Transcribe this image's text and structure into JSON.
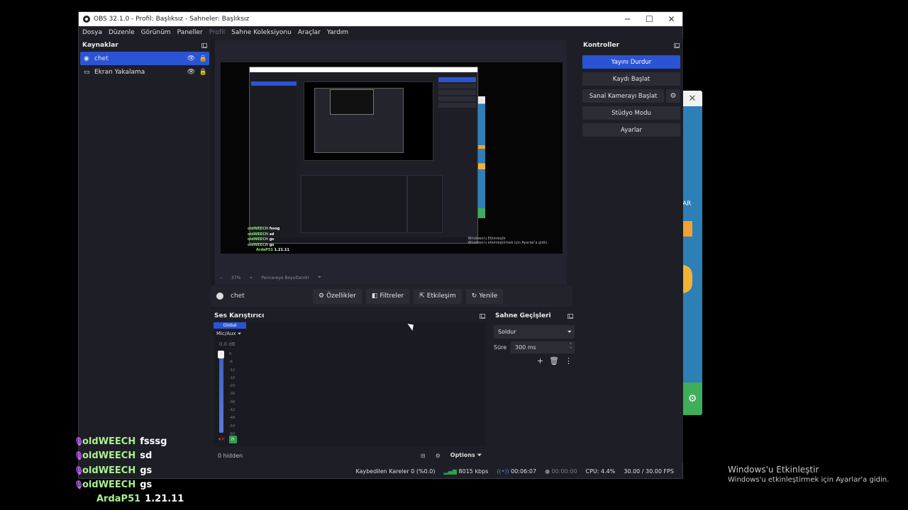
{
  "window": {
    "title": "OBS 32.1.0 - Profil: Başlıksız - Sahneler: Başlıksız",
    "minimize": "─",
    "maximize": "☐",
    "close": "✕"
  },
  "menu": [
    "Dosya",
    "Düzenle",
    "Görünüm",
    "Paneller",
    "Profil",
    "Sahne Koleksiyonu",
    "Araçlar",
    "Yardım"
  ],
  "sources": {
    "title": "Kaynaklar",
    "items": [
      {
        "label": "chet",
        "icon": "mic-icon",
        "selected": true
      },
      {
        "label": "Ekran Yakalama",
        "icon": "monitor-icon",
        "selected": false
      }
    ]
  },
  "preview": {
    "zoom": "37%",
    "zoom_mode": "Pencereye Boyutlandır",
    "mini_chat": [
      {
        "name": "oldWEECH",
        "msg": "fsssg"
      },
      {
        "name": "oldWEECH",
        "msg": "sd"
      },
      {
        "name": "oldWEECH",
        "msg": "gs"
      },
      {
        "name": "oldWEECH",
        "msg": "gs"
      },
      {
        "name": "ArdaP51",
        "msg": "1.21.11"
      }
    ],
    "mini_watermark_1": "Windows'u Etkinleştir",
    "mini_watermark_2": "Windows'u etkinleştirmek için Ayarlar'a gidin."
  },
  "context_bar": {
    "source_name": "chet",
    "buttons": [
      {
        "label": "Özellikler",
        "icon": "gear-icon"
      },
      {
        "label": "Filtreler",
        "icon": "filter-icon"
      },
      {
        "label": "Etkileşim",
        "icon": "pointer-icon"
      },
      {
        "label": "Yenile",
        "icon": "refresh-icon"
      }
    ]
  },
  "mixer": {
    "title": "Ses Karıştırıcı",
    "channel_scope": "Global",
    "channel_device": "Mic/Aux",
    "level": "0.0 dB",
    "scale": [
      "0",
      "-6",
      "-12",
      "-18",
      "-20",
      "-30",
      "-36",
      "-42",
      "-48",
      "-54",
      "-60"
    ],
    "hidden": "0 hidden",
    "options": "Options"
  },
  "transitions": {
    "title": "Sahne Geçişleri",
    "selected": "Soldur",
    "duration_label": "Süre",
    "duration_value": "300 ms"
  },
  "controls": {
    "title": "Kontroller",
    "stop_stream": "Yayını Durdur",
    "start_record": "Kaydı Başlat",
    "start_virtualcam": "Sanal Kamerayı Başlat",
    "studio_mode": "Stüdyo Modu",
    "settings": "Ayarlar"
  },
  "status": {
    "dropped": "Kaybedilen Kareler 0 (%0.0)",
    "bitrate": "8015 kbps",
    "stream_time": "00:06:07",
    "record_time": "00:00:00",
    "cpu": "CPU: 4.4%",
    "fps": "30.00 / 30.00 FPS"
  },
  "chat": [
    {
      "name": "oldWEECH",
      "msg": "fsssg",
      "mic": true
    },
    {
      "name": "oldWEECH",
      "msg": "sd",
      "mic": true
    },
    {
      "name": "oldWEECH",
      "msg": "gs",
      "mic": true
    },
    {
      "name": "oldWEECH",
      "msg": "gs",
      "mic": true
    },
    {
      "name": "ArdaP51",
      "msg": "1.21.11",
      "mic": false
    }
  ],
  "watermark": {
    "line1": "Windows'u Etkinleştir",
    "line2": "Windows'u etkinleştirmek için Ayarlar'a gidin."
  },
  "colors": {
    "accent": "#2b54d5",
    "panel": "#1e1f26",
    "chat_name": "#a8f08f"
  }
}
